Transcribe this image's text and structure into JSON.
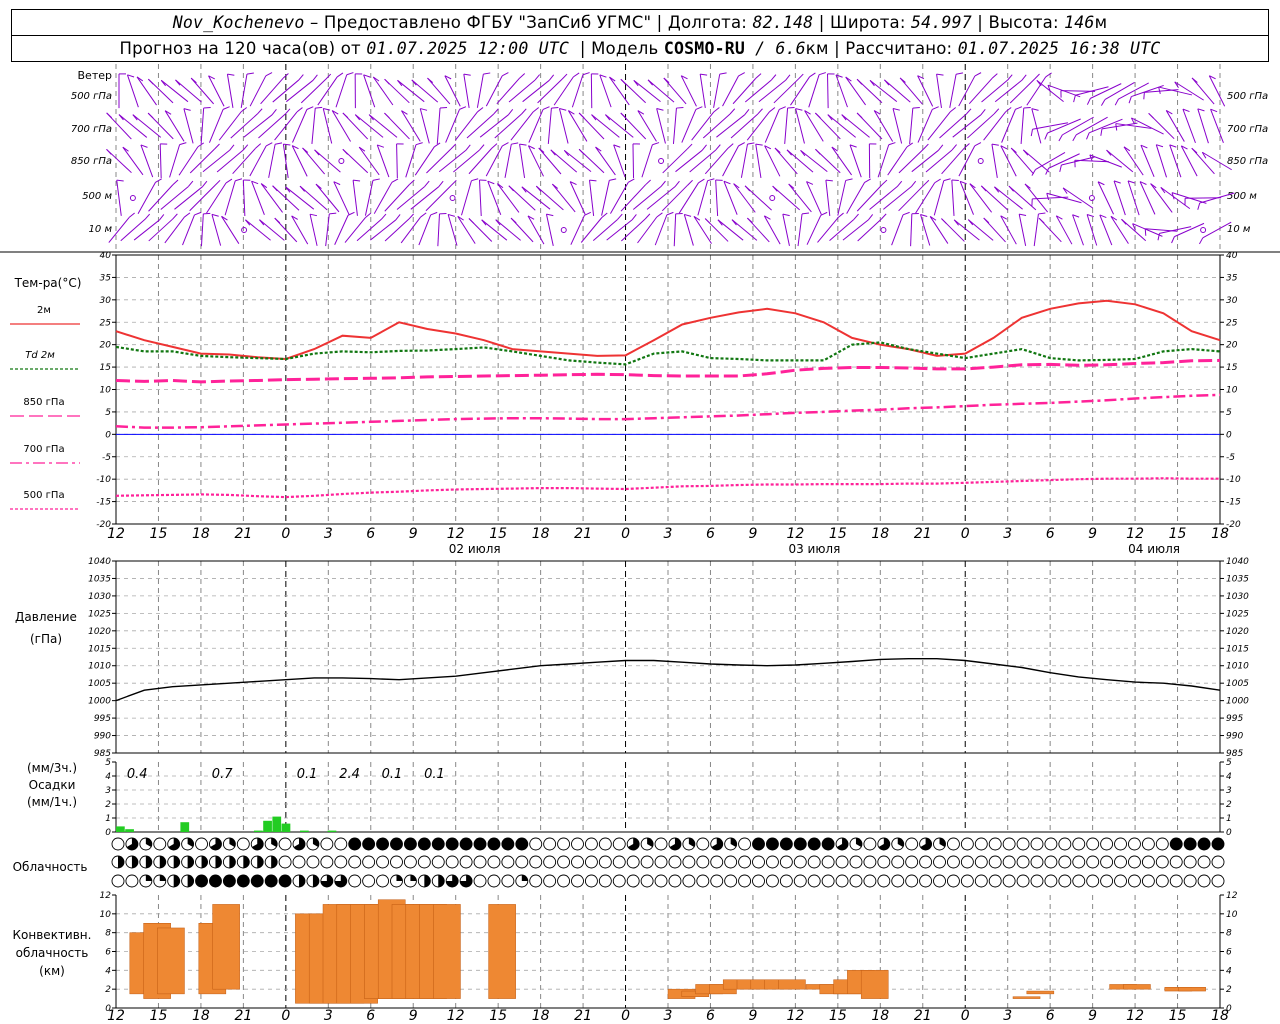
{
  "header": {
    "station": "Nov_Kochenevo",
    "provider": " – Предоставлено ФГБУ \"ЗапСиб УГМС\" | Долгота: ",
    "lon": "82.148",
    "lat_label": " | Широта: ",
    "lat": "54.997",
    "alt_label": " | Высота: ",
    "alt": "146",
    "alt_unit": "м",
    "forecast_label": "Прогноз на 120 часа(ов) от ",
    "forecast_from": "01.07.2025 12:00 UTC",
    "model_label": "  | Модель ",
    "model_name": "COSMO-RU",
    "model_res": " / 6.6",
    "model_res_unit": "км",
    "computed_label": " | Рассчитано: ",
    "computed": "01.07.2025 16:38 UTC"
  },
  "chart_data": {
    "type": "meteogram",
    "time_ticks": [
      "12",
      "15",
      "18",
      "21",
      "0",
      "3",
      "6",
      "9",
      "12",
      "15",
      "18",
      "21",
      "0",
      "3",
      "6",
      "9",
      "12",
      "15",
      "18",
      "21",
      "0",
      "3",
      "6",
      "9",
      "12",
      "15",
      "18"
    ],
    "date_labels": [
      {
        "tick": 8,
        "text": "02 июля"
      },
      {
        "tick": 16,
        "text": "03 июля"
      },
      {
        "tick": 24,
        "text": "04 июля"
      }
    ],
    "wind": {
      "panel_label": "Ветер",
      "levels": [
        "500 гПа",
        "700 гПа",
        "850 гПа",
        "500 м",
        "10 м"
      ]
    },
    "temperature": {
      "panel_label": "Тем-ра(°C)",
      "ylim": [
        -20,
        40
      ],
      "ticks": [
        -20,
        -15,
        -10,
        -5,
        0,
        5,
        10,
        15,
        20,
        25,
        30,
        35,
        40
      ],
      "series": [
        {
          "name": "2м",
          "color": "#ee3333",
          "style": "solid",
          "values": [
            23,
            21,
            19.5,
            18,
            17.8,
            17.2,
            16.8,
            19,
            22,
            21.5,
            25,
            23.5,
            22.5,
            21,
            19,
            18.5,
            18,
            17.5,
            17.6,
            21,
            24.5,
            26,
            27.2,
            28,
            27,
            25,
            21.5,
            20,
            19,
            17.5,
            18,
            21.5,
            26,
            28,
            29.2,
            29.8,
            29,
            27,
            23,
            21
          ]
        },
        {
          "name": "Td 2м",
          "color": "#117711",
          "style": "dotted",
          "values": [
            19.5,
            18.5,
            18.5,
            17.5,
            17.2,
            17,
            16.8,
            18,
            18.5,
            18.3,
            18.6,
            18.7,
            19,
            19.4,
            18.5,
            17.5,
            16.5,
            16,
            15.6,
            18,
            18.5,
            17,
            16.8,
            16.5,
            16.5,
            16.5,
            20,
            20.5,
            19,
            18,
            17,
            18,
            19,
            17,
            16.5,
            16.6,
            16.8,
            18.5,
            19,
            18.5
          ]
        },
        {
          "name": "850 гПа",
          "color": "#ff2299",
          "style": "dashed",
          "values": [
            12,
            11.8,
            12,
            11.7,
            11.9,
            12,
            12.2,
            12.3,
            12.4,
            12.5,
            12.6,
            12.8,
            12.9,
            13,
            13.1,
            13.2,
            13.3,
            13.4,
            13.3,
            13.1,
            13,
            13,
            13,
            13.5,
            14.3,
            14.7,
            14.9,
            14.9,
            14.8,
            14.6,
            14.6,
            15,
            15.5,
            15.6,
            15.4,
            15.5,
            15.8,
            16,
            16.4,
            16.5
          ]
        },
        {
          "name": "700 гПа",
          "color": "#ff2299",
          "style": "dashdot",
          "values": [
            1.8,
            1.5,
            1.5,
            1.6,
            1.8,
            2,
            2.2,
            2.4,
            2.6,
            2.8,
            3,
            3.2,
            3.4,
            3.5,
            3.6,
            3.6,
            3.5,
            3.4,
            3.4,
            3.6,
            3.8,
            4,
            4.2,
            4.5,
            4.8,
            5,
            5.3,
            5.5,
            5.8,
            6,
            6.3,
            6.6,
            6.8,
            7,
            7.3,
            7.6,
            8,
            8.3,
            8.6,
            8.8
          ]
        },
        {
          "name": "500 гПа",
          "color": "#ff2299",
          "style": "dotted",
          "values": [
            -13.7,
            -13.6,
            -13.5,
            -13.4,
            -13.5,
            -13.8,
            -14,
            -13.7,
            -13.3,
            -13,
            -12.8,
            -12.5,
            -12.3,
            -12.2,
            -12.1,
            -12,
            -12,
            -12.1,
            -12.2,
            -11.9,
            -11.6,
            -11.5,
            -11.3,
            -11.2,
            -11.2,
            -11.1,
            -11.1,
            -11.1,
            -11,
            -11,
            -10.8,
            -10.6,
            -10.4,
            -10.2,
            -10,
            -9.9,
            -9.9,
            -9.8,
            -9.9,
            -9.9
          ]
        }
      ]
    },
    "pressure": {
      "panel_label": "Давление",
      "unit": "(гПа)",
      "ylim": [
        985,
        1040
      ],
      "ticks": [
        985,
        990,
        995,
        1000,
        1005,
        1010,
        1015,
        1020,
        1025,
        1030,
        1035,
        1040
      ],
      "values": [
        1000,
        1003,
        1004,
        1004.5,
        1005,
        1005.5,
        1006,
        1006.5,
        1006.5,
        1006.3,
        1006,
        1006.5,
        1007,
        1008,
        1009,
        1010,
        1010.5,
        1011,
        1011.5,
        1011.5,
        1011,
        1010.5,
        1010.2,
        1010,
        1010.2,
        1010.7,
        1011.2,
        1011.8,
        1012,
        1012,
        1011.5,
        1010.5,
        1009.5,
        1008,
        1006.8,
        1006,
        1005.3,
        1005,
        1004.2,
        1003
      ]
    },
    "precipitation": {
      "panel_label": "Осадки",
      "unit_3h": "(мм/3ч.)",
      "unit_1h": "(мм/1ч.)",
      "ylim": [
        0,
        5
      ],
      "ticks": [
        0,
        1,
        2,
        3,
        4,
        5
      ],
      "totals_3h": [
        {
          "tick": 0.5,
          "value": "0.4"
        },
        {
          "tick": 2.5,
          "value": "0.7"
        },
        {
          "tick": 4.5,
          "value": "0.1"
        },
        {
          "tick": 5.5,
          "value": "2.4"
        },
        {
          "tick": 6.5,
          "value": "0.1"
        },
        {
          "tick": 7.5,
          "value": "0.1"
        }
      ],
      "bars_1h": [
        {
          "hour": 1,
          "value": 0.4
        },
        {
          "hour": 2,
          "value": 0.2
        },
        {
          "hour": 8,
          "value": 0.7
        },
        {
          "hour": 16,
          "value": 0.1
        },
        {
          "hour": 17,
          "value": 0.8
        },
        {
          "hour": 18,
          "value": 1.1
        },
        {
          "hour": 19,
          "value": 0.6
        },
        {
          "hour": 21,
          "value": 0.1
        },
        {
          "hour": 24,
          "value": 0.1
        }
      ]
    },
    "cloudiness": {
      "panel_label": "Облачность"
    },
    "convective": {
      "panel_label": [
        "Конвективн.",
        "облачность",
        "(км)"
      ],
      "ylim": [
        0,
        12
      ],
      "ticks": [
        0,
        2,
        4,
        6,
        8,
        10,
        12
      ],
      "bars": [
        {
          "t": 0.5,
          "base": 1.5,
          "top": 8
        },
        {
          "t": 1,
          "base": 1,
          "top": 9
        },
        {
          "t": 1.5,
          "base": 1.5,
          "top": 8.5
        },
        {
          "t": 3,
          "base": 1.5,
          "top": 9
        },
        {
          "t": 3.5,
          "base": 2,
          "top": 11
        },
        {
          "t": 6.5,
          "base": 0.5,
          "top": 10
        },
        {
          "t": 7,
          "base": 0.5,
          "top": 10
        },
        {
          "t": 7.5,
          "base": 0.5,
          "top": 11
        },
        {
          "t": 8,
          "base": 0.5,
          "top": 11
        },
        {
          "t": 8.5,
          "base": 0.5,
          "top": 11
        },
        {
          "t": 9,
          "base": 1,
          "top": 11
        },
        {
          "t": 9.5,
          "base": 1,
          "top": 11.5
        },
        {
          "t": 10,
          "base": 1,
          "top": 11
        },
        {
          "t": 10.5,
          "base": 1,
          "top": 11
        },
        {
          "t": 11,
          "base": 1,
          "top": 11
        },
        {
          "t": 11.5,
          "base": 1,
          "top": 11
        },
        {
          "t": 13.5,
          "base": 1,
          "top": 11
        },
        {
          "t": 20,
          "base": 1,
          "top": 2
        },
        {
          "t": 20.5,
          "base": 1.2,
          "top": 1.8
        },
        {
          "t": 21,
          "base": 1.5,
          "top": 2.5
        },
        {
          "t": 21.5,
          "base": 1.5,
          "top": 2.5
        },
        {
          "t": 22,
          "base": 2,
          "top": 3
        },
        {
          "t": 22.5,
          "base": 2,
          "top": 3
        },
        {
          "t": 23,
          "base": 2,
          "top": 3
        },
        {
          "t": 23.5,
          "base": 2,
          "top": 3
        },
        {
          "t": 24,
          "base": 2,
          "top": 3
        },
        {
          "t": 25,
          "base": 2,
          "top": 2.5
        },
        {
          "t": 25.5,
          "base": 1.5,
          "top": 2.5
        },
        {
          "t": 26,
          "base": 1.5,
          "top": 3
        },
        {
          "t": 26.5,
          "base": 1.5,
          "top": 4
        },
        {
          "t": 27,
          "base": 1,
          "top": 4
        },
        {
          "t": 32.5,
          "base": 1,
          "top": 1.2
        },
        {
          "t": 33,
          "base": 1.5,
          "top": 1.8
        },
        {
          "t": 36,
          "base": 2,
          "top": 2.5
        },
        {
          "t": 36.5,
          "base": 2,
          "top": 2.5
        },
        {
          "t": 38,
          "base": 1.8,
          "top": 2.2
        },
        {
          "t": 38.5,
          "base": 1.8,
          "top": 2.2
        }
      ]
    },
    "colors": {
      "wind_barb": "#8800cc",
      "convective": "#ee8833",
      "precip": "#22cc22",
      "zero_line": "#0000ff",
      "grid": "#888888"
    }
  }
}
